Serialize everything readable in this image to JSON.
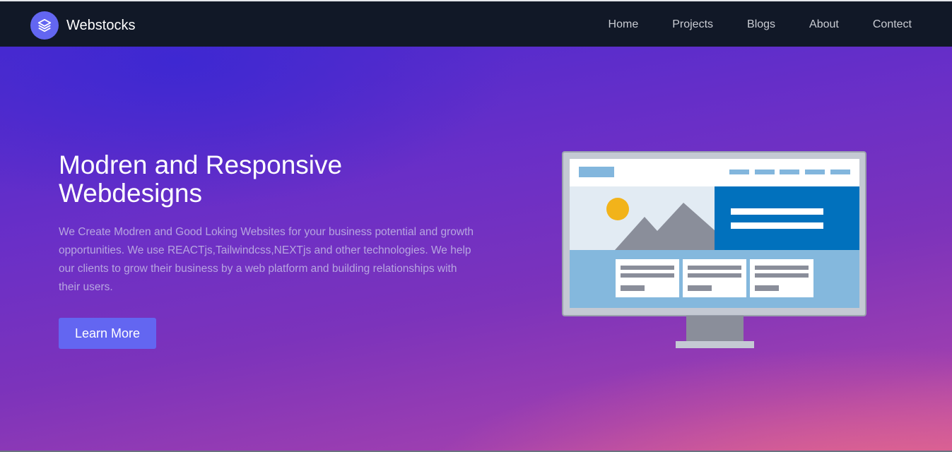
{
  "brand": {
    "name": "Webstocks",
    "logo_icon": "layers-icon"
  },
  "nav": {
    "items": [
      {
        "label": "Home"
      },
      {
        "label": "Projects"
      },
      {
        "label": "Blogs"
      },
      {
        "label": "About"
      },
      {
        "label": "Contect"
      }
    ]
  },
  "hero": {
    "title": "Modren and Responsive Webdesigns",
    "description": "We Create Modren and Good Loking Websites for your business potential and growth opportunities. We use REACTjs,Tailwindcss,NEXTjs and other technologies. We help our clients to grow their business by a web platform and building relationships with their users.",
    "cta_label": "Learn More",
    "illustration_icon": "monitor-website-icon"
  },
  "colors": {
    "navbar_bg": "#111827",
    "accent": "#6366f1",
    "hero_gradient_start": "#4a2ad0",
    "hero_gradient_end": "#c555a3"
  }
}
